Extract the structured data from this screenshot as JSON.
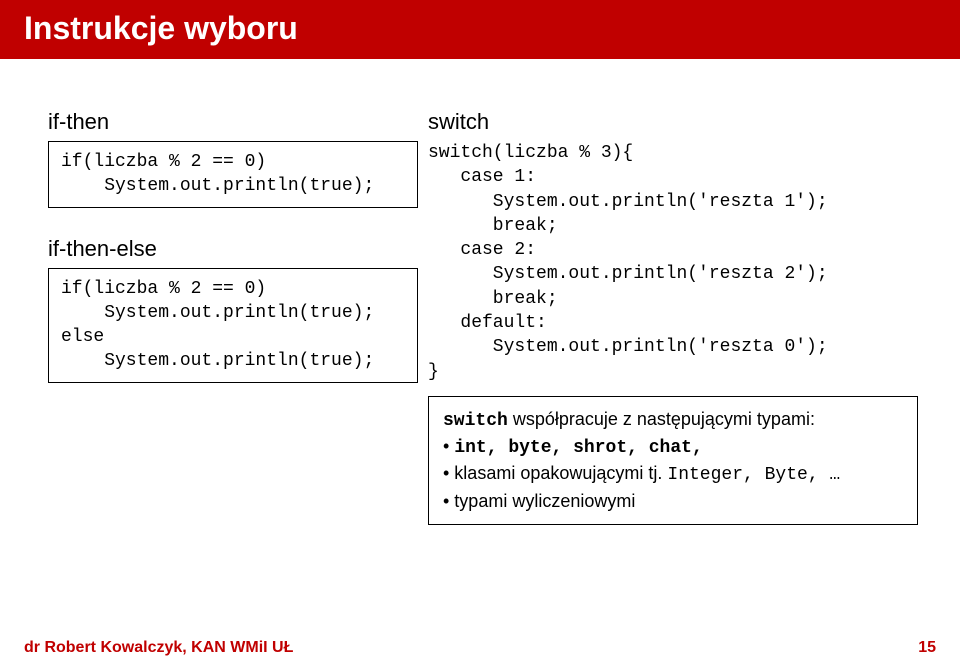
{
  "header": {
    "title": "Instrukcje wyboru"
  },
  "left": {
    "section1_label": "if-then",
    "section1_code": "if(liczba % 2 == 0)\n    System.out.println(true);",
    "section2_label": "if-then-else",
    "section2_code": "if(liczba % 2 == 0)\n    System.out.println(true);\nelse\n    System.out.println(true);"
  },
  "right": {
    "section_label": "switch",
    "code": "switch(liczba % 3){\n   case 1:\n      System.out.println('reszta 1');\n      break;\n   case 2:\n      System.out.println('reszta 2');\n      break;\n   default:\n      System.out.println('reszta 0');\n}",
    "note_intro_prefix_mono": "switch",
    "note_intro_rest": " współpracuje z następującymi typami:",
    "note_bullet1_prefix": "• ",
    "note_bullet1_items": "int, byte, shrot, chat,",
    "note_bullet2_prefix": "• klasami opakowującymi tj. ",
    "note_bullet2_items": "Integer, Byte, …",
    "note_bullet3": "• typami wyliczeniowymi"
  },
  "footer": {
    "left": "dr Robert Kowalczyk, KAN WMiI UŁ",
    "right": "15"
  }
}
